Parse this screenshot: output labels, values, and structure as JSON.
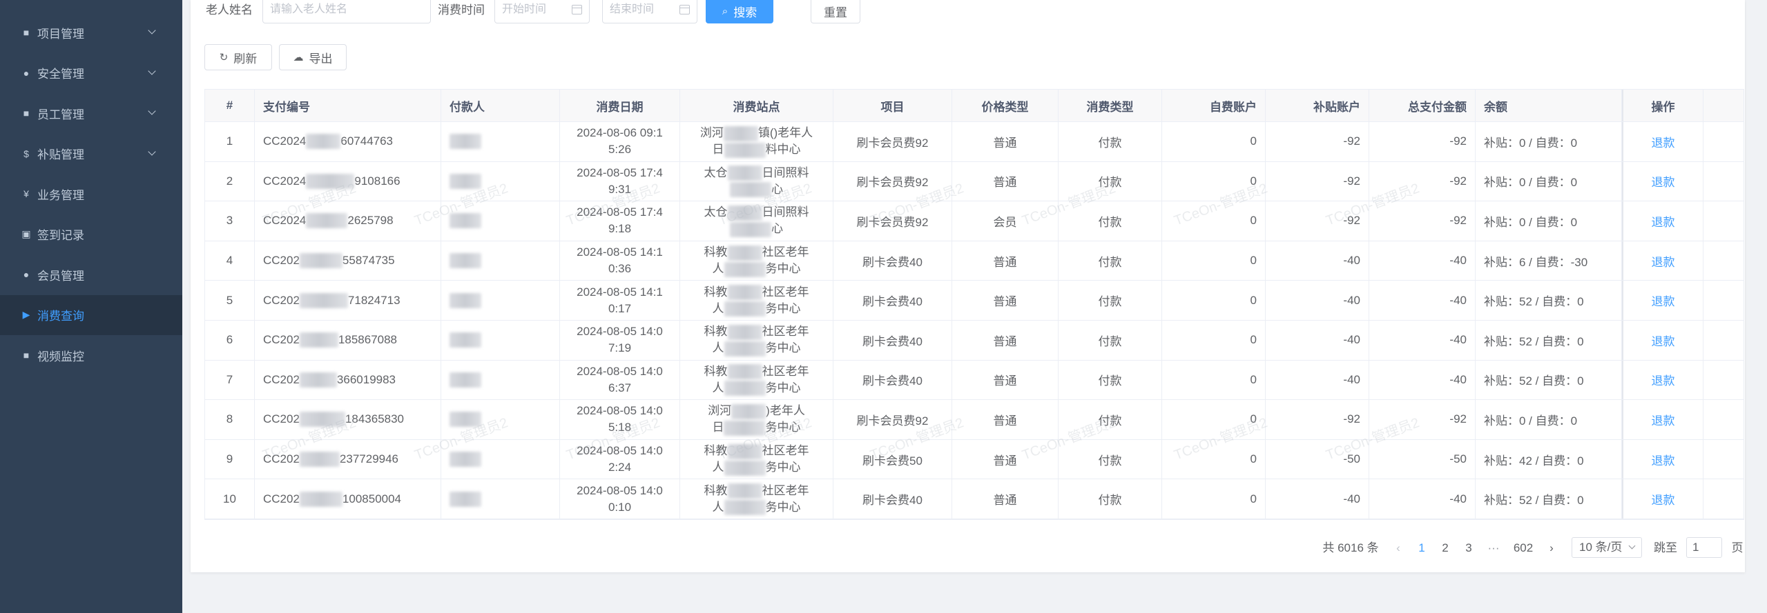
{
  "sidebar": {
    "items": [
      {
        "label": "项目管理",
        "icon": "folder-icon",
        "glyph": "■",
        "has_arrow": true
      },
      {
        "label": "安全管理",
        "icon": "location-icon",
        "glyph": "●",
        "has_arrow": true
      },
      {
        "label": "员工管理",
        "icon": "document-icon",
        "glyph": "■",
        "has_arrow": true
      },
      {
        "label": "补贴管理",
        "icon": "dollar-icon",
        "glyph": "$",
        "has_arrow": true
      },
      {
        "label": "业务管理",
        "icon": "yen-icon",
        "glyph": "¥",
        "has_arrow": false
      },
      {
        "label": "签到记录",
        "icon": "clipboard-icon",
        "glyph": "▣",
        "has_arrow": false
      },
      {
        "label": "会员管理",
        "icon": "user-icon",
        "glyph": "●",
        "has_arrow": false
      },
      {
        "label": "消费查询",
        "icon": "flag-icon",
        "glyph": "▶",
        "has_arrow": false,
        "active": true
      },
      {
        "label": "视频监控",
        "icon": "video-camera-icon",
        "glyph": "■",
        "has_arrow": false
      }
    ]
  },
  "search": {
    "name_label": "老人姓名",
    "name_placeholder": "请输入老人姓名",
    "time_label": "消费时间",
    "start_placeholder": "开始时间",
    "end_placeholder": "结束时间",
    "search_label": "搜索",
    "reset_label": "重置"
  },
  "toolbar": {
    "refresh_label": "刷新",
    "export_label": "导出"
  },
  "table": {
    "headers": [
      "#",
      "支付编号",
      "付款人",
      "消费日期",
      "消费站点",
      "项目",
      "价格类型",
      "消费类型",
      "自费账户",
      "补贴账户",
      "总支付金额",
      "余额",
      "操作"
    ],
    "rows": [
      {
        "no": "1",
        "pay_pre": "CC2024",
        "pay_suf": "60744763",
        "date1": "2024-08-06 09:1",
        "date2": "5:26",
        "site1": "浏河",
        "site1b": "镇(",
        "site1c": ")老年人",
        "site2": "日",
        "site2b": "料",
        "site2c": "中心",
        "item": "刷卡会员费92",
        "price_type": "普通",
        "consume_type": "付款",
        "self": "0",
        "subsidy": "-92",
        "total": "-92",
        "balance": "补贴：0 / 自费：0",
        "op": "退款"
      },
      {
        "no": "2",
        "pay_pre": "CC2024",
        "pay_suf": "9108166",
        "date1": "2024-08-05 17:4",
        "date2": "9:31",
        "site1": "太仓",
        "site1b": "",
        "site1c": "日间照料",
        "site2": "",
        "site2b": "",
        "site2c": "心",
        "item": "刷卡会员费92",
        "price_type": "普通",
        "consume_type": "付款",
        "self": "0",
        "subsidy": "-92",
        "total": "-92",
        "balance": "补贴：0 / 自费：0",
        "op": "退款"
      },
      {
        "no": "3",
        "pay_pre": "CC2024",
        "pay_suf": "2625798",
        "date1": "2024-08-05 17:4",
        "date2": "9:18",
        "site1": "太仓",
        "site1b": "",
        "site1c": "日间照料",
        "site2": "",
        "site2b": "",
        "site2c": "心",
        "item": "刷卡会员费92",
        "price_type": "会员",
        "consume_type": "付款",
        "self": "0",
        "subsidy": "-92",
        "total": "-92",
        "balance": "补贴：0 / 自费：0",
        "op": "退款"
      },
      {
        "no": "4",
        "pay_pre": "CC202",
        "pay_suf": "55874735",
        "date1": "2024-08-05 14:1",
        "date2": "0:36",
        "site1": "科教",
        "site1b": "",
        "site1c": "社区老年",
        "site2": "人",
        "site2b": "",
        "site2c": "务中心",
        "item": "刷卡会费40",
        "price_type": "普通",
        "consume_type": "付款",
        "self": "0",
        "subsidy": "-40",
        "total": "-40",
        "balance": "补贴：6 / 自费：-30",
        "op": "退款"
      },
      {
        "no": "5",
        "pay_pre": "CC202",
        "pay_suf": "71824713",
        "date1": "2024-08-05 14:1",
        "date2": "0:17",
        "site1": "科教",
        "site1b": "",
        "site1c": "社区老年",
        "site2": "人",
        "site2b": "",
        "site2c": "务中心",
        "item": "刷卡会费40",
        "price_type": "普通",
        "consume_type": "付款",
        "self": "0",
        "subsidy": "-40",
        "total": "-40",
        "balance": "补贴：52 / 自费：0",
        "op": "退款"
      },
      {
        "no": "6",
        "pay_pre": "CC202",
        "pay_suf": "185867088",
        "date1": "2024-08-05 14:0",
        "date2": "7:19",
        "site1": "科教",
        "site1b": "",
        "site1c": "社区老年",
        "site2": "人",
        "site2b": "",
        "site2c": "务中心",
        "item": "刷卡会费40",
        "price_type": "普通",
        "consume_type": "付款",
        "self": "0",
        "subsidy": "-40",
        "total": "-40",
        "balance": "补贴：52 / 自费：0",
        "op": "退款"
      },
      {
        "no": "7",
        "pay_pre": "CC202",
        "pay_suf": "366019983",
        "date1": "2024-08-05 14:0",
        "date2": "6:37",
        "site1": "科教",
        "site1b": "",
        "site1c": "社区老年",
        "site2": "人",
        "site2b": "",
        "site2c": "务中心",
        "item": "刷卡会费40",
        "price_type": "普通",
        "consume_type": "付款",
        "self": "0",
        "subsidy": "-40",
        "total": "-40",
        "balance": "补贴：52 / 自费：0",
        "op": "退款"
      },
      {
        "no": "8",
        "pay_pre": "CC202",
        "pay_suf": "184365830",
        "date1": "2024-08-05 14:0",
        "date2": "5:18",
        "site1": "浏河",
        "site1b": "",
        "site1c": ")老年人",
        "site2": "日",
        "site2b": "",
        "site2c": "务中心",
        "item": "刷卡会员费92",
        "price_type": "普通",
        "consume_type": "付款",
        "self": "0",
        "subsidy": "-92",
        "total": "-92",
        "balance": "补贴：0 / 自费：0",
        "op": "退款"
      },
      {
        "no": "9",
        "pay_pre": "CC202",
        "pay_suf": "237729946",
        "date1": "2024-08-05 14:0",
        "date2": "2:24",
        "site1": "科教",
        "site1b": "",
        "site1c": "社区老年",
        "site2": "人",
        "site2b": "",
        "site2c": "务中心",
        "item": "刷卡会费50",
        "price_type": "普通",
        "consume_type": "付款",
        "self": "0",
        "subsidy": "-50",
        "total": "-50",
        "balance": "补贴：42 / 自费：0",
        "op": "退款"
      },
      {
        "no": "10",
        "pay_pre": "CC202",
        "pay_suf": "100850004",
        "date1": "2024-08-05 14:0",
        "date2": "0:10",
        "site1": "科教",
        "site1b": "",
        "site1c": "社区老年",
        "site2": "人",
        "site2b": "",
        "site2c": "务中心",
        "item": "刷卡会费40",
        "price_type": "普通",
        "consume_type": "付款",
        "self": "0",
        "subsidy": "-40",
        "total": "-40",
        "balance": "补贴：52 / 自费：0",
        "op": "退款"
      }
    ]
  },
  "pagination": {
    "total_text": "共 6016 条",
    "pages": [
      "1",
      "2",
      "3"
    ],
    "ellipsis": "···",
    "last_page": "602",
    "page_size": "10 条/页",
    "jump_label": "跳至",
    "jump_value": "1",
    "page_suffix": "页"
  },
  "watermark": "TCeOn-管理员2",
  "colors": {
    "sidebar_bg": "#304156",
    "active_bg": "#263445",
    "accent": "#409eff"
  }
}
